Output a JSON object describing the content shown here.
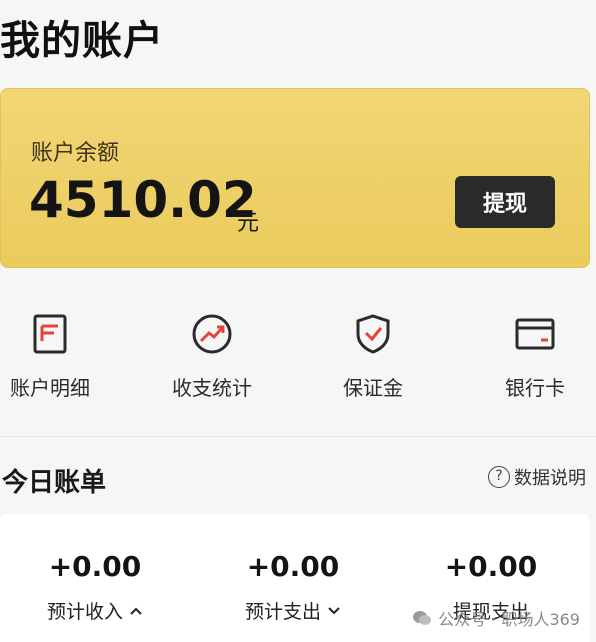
{
  "page": {
    "title": "我的账户"
  },
  "balance": {
    "label": "账户余额",
    "amount": "4510.02",
    "unit": "元",
    "withdraw_label": "提现",
    "accent": "#f0d36a"
  },
  "menu": {
    "items": [
      {
        "label": "账户明细",
        "icon": "document-list-icon"
      },
      {
        "label": "收支统计",
        "icon": "trend-chart-icon"
      },
      {
        "label": "保证金",
        "icon": "shield-check-icon"
      },
      {
        "label": "银行卡",
        "icon": "bank-card-icon"
      }
    ],
    "icon_color": "#2b2b2b",
    "icon_accent": "#e0463b"
  },
  "bills": {
    "title": "今日账单",
    "help_label": "数据说明",
    "stats": [
      {
        "value": "+0.00",
        "label": "预计收入"
      },
      {
        "value": "+0.00",
        "label": "预计支出"
      },
      {
        "value": "+0.00",
        "label": "提现支出"
      }
    ]
  },
  "watermark": {
    "text": "公众号 · 职场人369"
  }
}
